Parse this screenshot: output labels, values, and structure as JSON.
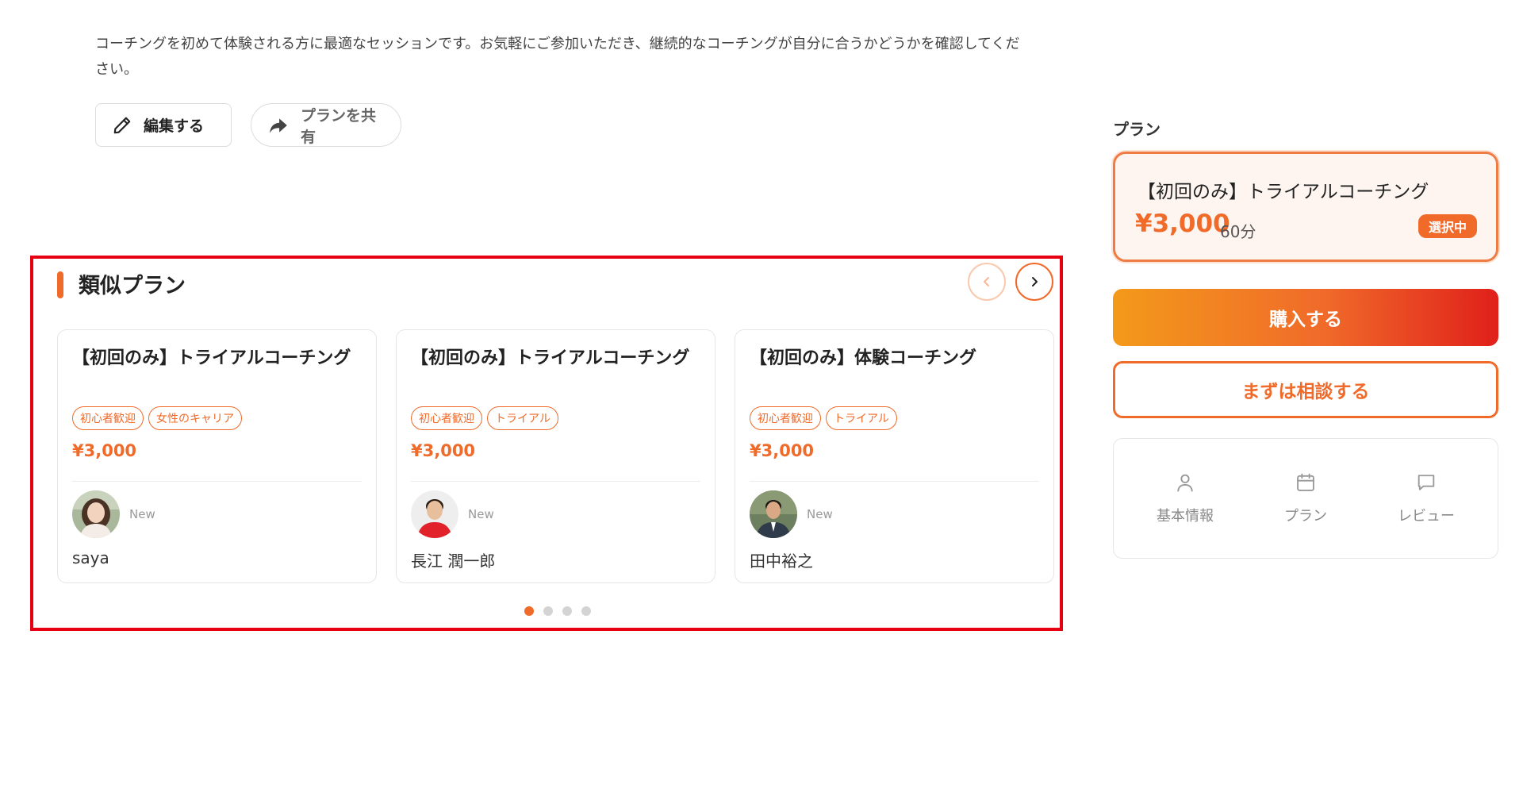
{
  "description": "コーチングを初めて体験される方に最適なセッションです。お気軽にご参加いただき、継続的なコーチングが自分に合うかどうかを確認してください。",
  "actions": {
    "edit_label": "編集する",
    "share_label": "プランを共有"
  },
  "similar": {
    "title": "類似プラン",
    "cards": [
      {
        "title": "【初回のみ】トライアルコーチング",
        "tags": [
          "初心者歓迎",
          "女性のキャリア"
        ],
        "price": "¥3,000",
        "badge": "New",
        "coach_name": "saya"
      },
      {
        "title": "【初回のみ】トライアルコーチング",
        "tags": [
          "初心者歓迎",
          "トライアル"
        ],
        "price": "¥3,000",
        "badge": "New",
        "coach_name": "長江 潤一郎"
      },
      {
        "title": "【初回のみ】体験コーチング",
        "tags": [
          "初心者歓迎",
          "トライアル"
        ],
        "price": "¥3,000",
        "badge": "New",
        "coach_name": "田中裕之"
      }
    ],
    "pagination": {
      "total": 4,
      "active": 0
    }
  },
  "sidebar": {
    "plan_label": "プラン",
    "selected_plan": {
      "title": "【初回のみ】トライアルコーチング",
      "price": "¥3,000",
      "duration": "60分",
      "badge": "選択中"
    },
    "buy_label": "購入する",
    "consult_label": "まずは相談する",
    "tabs": [
      {
        "label": "基本情報",
        "icon": "person-icon"
      },
      {
        "label": "プラン",
        "icon": "calendar-icon"
      },
      {
        "label": "レビュー",
        "icon": "chat-icon"
      }
    ]
  },
  "colors": {
    "accent": "#f06a2a",
    "highlight_border": "#e60012",
    "muted_text": "#888888"
  }
}
